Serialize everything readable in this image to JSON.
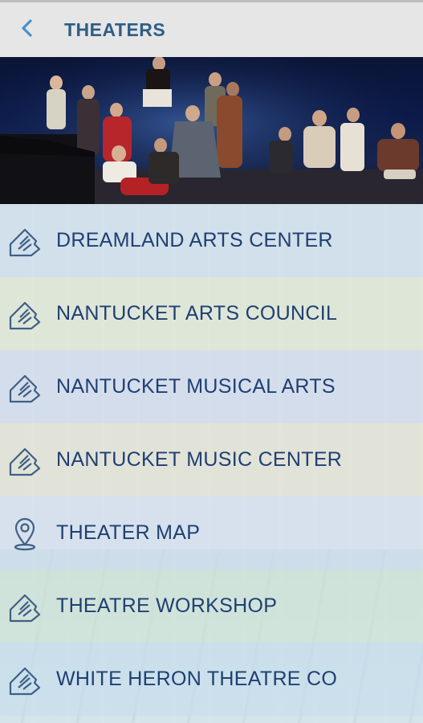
{
  "header": {
    "title": "THEATERS",
    "back_icon": "chevron-left-icon"
  },
  "hero": {
    "alt_subject": "stage-performance-photo"
  },
  "items": [
    {
      "label": "DREAMLAND ARTS CENTER",
      "icon": "ticket-icon"
    },
    {
      "label": "NANTUCKET ARTS COUNCIL",
      "icon": "ticket-icon"
    },
    {
      "label": "NANTUCKET MUSICAL ARTS",
      "icon": "ticket-icon"
    },
    {
      "label": "NANTUCKET MUSIC CENTER",
      "icon": "ticket-icon"
    },
    {
      "label": "THEATER MAP",
      "icon": "map-pin-icon"
    },
    {
      "label": "THEATRE WORKSHOP",
      "icon": "ticket-icon"
    },
    {
      "label": "WHITE HERON THEATRE CO",
      "icon": "ticket-icon"
    }
  ],
  "colors": {
    "accent": "#2e5e86",
    "label": "#1f3f73",
    "header_bg": "#e6e6e6",
    "icon_back": "#4a8fd0"
  }
}
